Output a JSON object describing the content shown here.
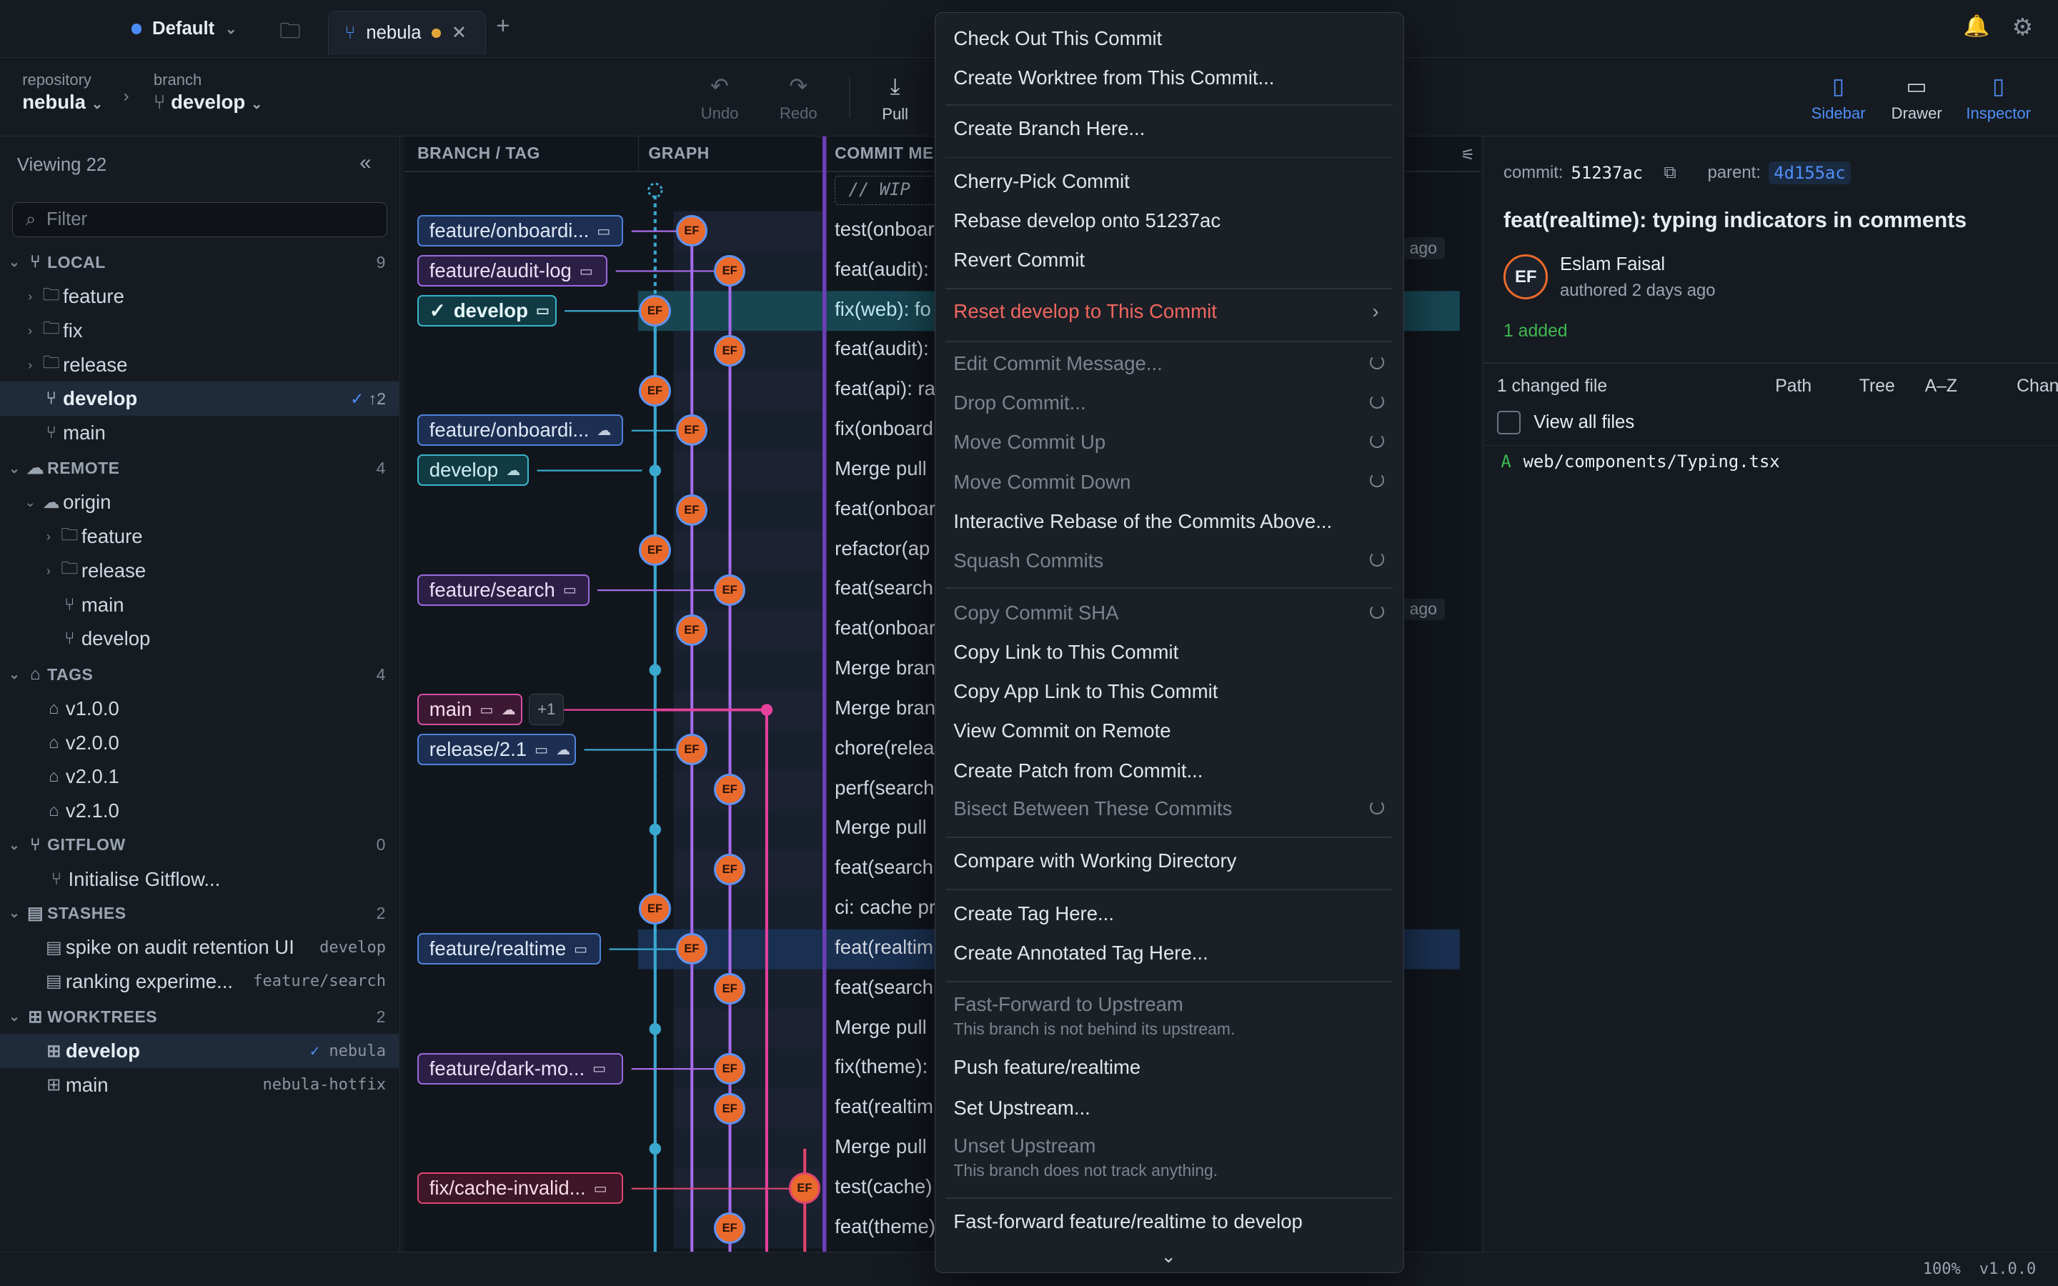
{
  "titlebar": {
    "workspace": "Default",
    "tab_label": "nebula",
    "new_tab": "+"
  },
  "toolbar": {
    "repo_caption": "repository",
    "repo_name": "nebula",
    "branch_caption": "branch",
    "branch_name": "develop",
    "undo": "Undo",
    "redo": "Redo",
    "pull": "Pull",
    "sidebar": "Sidebar",
    "drawer": "Drawer",
    "inspector": "Inspector"
  },
  "sidebar": {
    "viewing": "Viewing 22",
    "filter_placeholder": "Filter",
    "local": {
      "title": "LOCAL",
      "count": "9",
      "folders": [
        "feature",
        "fix",
        "release"
      ],
      "develop": "develop",
      "develop_sync": "↑2",
      "main": "main"
    },
    "remote": {
      "title": "REMOTE",
      "count": "4",
      "origin": "origin",
      "items": [
        "feature",
        "release",
        "main",
        "develop"
      ]
    },
    "tags": {
      "title": "TAGS",
      "count": "4",
      "items": [
        "v1.0.0",
        "v2.0.0",
        "v2.0.1",
        "v2.1.0"
      ]
    },
    "gitflow": {
      "title": "GITFLOW",
      "count": "0",
      "item": "Initialise Gitflow..."
    },
    "stashes": {
      "title": "STASHES",
      "count": "2",
      "items": [
        {
          "label": "spike on audit retention UI",
          "branch": "develop"
        },
        {
          "label": "ranking experime...",
          "branch": "feature/search"
        }
      ]
    },
    "worktrees": {
      "title": "WORKTREES",
      "count": "2",
      "items": [
        {
          "label": "develop",
          "repo": "nebula"
        },
        {
          "label": "main",
          "repo": "nebula-hotfix"
        }
      ]
    }
  },
  "graph": {
    "col_branch": "BRANCH / TAG",
    "col_graph": "GRAPH",
    "col_message": "COMMIT MES",
    "wip": "// WIP",
    "avatar": "EF",
    "ago": "ago",
    "rows": [
      {
        "branch": "feature/onboardi...",
        "msg": "test(onboar"
      },
      {
        "branch": "feature/audit-log",
        "msg": "feat(audit):"
      },
      {
        "branch": "develop",
        "msg": "fix(web): fo"
      },
      {
        "branch": "",
        "msg": "feat(audit):"
      },
      {
        "branch": "",
        "msg": "feat(api): ra"
      },
      {
        "branch": "feature/onboardi...",
        "msg": "fix(onboard"
      },
      {
        "branch": "develop",
        "msg": "Merge pull"
      },
      {
        "branch": "",
        "msg": "feat(onboar"
      },
      {
        "branch": "",
        "msg": "refactor(ap"
      },
      {
        "branch": "feature/search",
        "msg": "feat(search"
      },
      {
        "branch": "",
        "msg": "feat(onboar"
      },
      {
        "branch": "",
        "msg": "Merge bran"
      },
      {
        "branch": "main",
        "msg": "Merge bran",
        "extra": "+1"
      },
      {
        "branch": "release/2.1",
        "msg": "chore(relea"
      },
      {
        "branch": "",
        "msg": "perf(search"
      },
      {
        "branch": "",
        "msg": "Merge pull"
      },
      {
        "branch": "",
        "msg": "feat(search"
      },
      {
        "branch": "",
        "msg": "ci: cache pr"
      },
      {
        "branch": "feature/realtime",
        "msg": "feat(realtim"
      },
      {
        "branch": "",
        "msg": "feat(search"
      },
      {
        "branch": "",
        "msg": "Merge pull"
      },
      {
        "branch": "feature/dark-mo...",
        "msg": "fix(theme):"
      },
      {
        "branch": "",
        "msg": "feat(realtim"
      },
      {
        "branch": "",
        "msg": "Merge pull"
      },
      {
        "branch": "fix/cache-invalid...",
        "msg": "test(cache)"
      },
      {
        "branch": "",
        "msg": "feat(theme)"
      }
    ]
  },
  "inspector": {
    "commit_label": "commit:",
    "commit_sha": "51237ac",
    "parent_label": "parent:",
    "parent_sha": "4d155ac",
    "title": "feat(realtime): typing indicators in comments",
    "avatar": "EF",
    "author": "Eslam Faisal",
    "authored": "authored 2 days ago",
    "added": "1 added",
    "changed": "1 changed file",
    "views": [
      "Path",
      "Tree",
      "A–Z",
      "Change"
    ],
    "view_all": "View all files",
    "file_status": "A",
    "file_path": "web/components/Typing.tsx"
  },
  "status": {
    "zoom": "100%",
    "version": "v1.0.0"
  },
  "menu": {
    "checkout": "Check Out This Commit",
    "worktree": "Create Worktree from This Commit...",
    "branch_here": "Create Branch Here...",
    "cherry": "Cherry-Pick Commit",
    "rebase": "Rebase develop onto 51237ac",
    "revert": "Revert Commit",
    "reset": "Reset develop to This Commit",
    "edit_msg": "Edit Commit Message...",
    "drop": "Drop Commit...",
    "move_up": "Move Commit Up",
    "move_down": "Move Commit Down",
    "interactive": "Interactive Rebase of the Commits Above...",
    "squash": "Squash Commits",
    "copy_sha": "Copy Commit SHA",
    "copy_link": "Copy Link to This Commit",
    "copy_app_link": "Copy App Link to This Commit",
    "view_remote": "View Commit on Remote",
    "patch": "Create Patch from Commit...",
    "bisect": "Bisect Between These Commits",
    "compare": "Compare with Working Directory",
    "tag": "Create Tag Here...",
    "ann_tag": "Create Annotated Tag Here...",
    "ff_upstream": "Fast-Forward to Upstream",
    "ff_upstream_sub": "This branch is not behind its upstream.",
    "push": "Push feature/realtime",
    "set_upstream": "Set Upstream...",
    "unset_upstream": "Unset Upstream",
    "unset_upstream_sub": "This branch does not track anything.",
    "ff_develop": "Fast-forward feature/realtime to develop"
  },
  "colors": {
    "accent": "#4f8ff7",
    "danger": "#f0665f",
    "node": "#ea6a2b",
    "lane1": "#3aa8cf",
    "lane2": "#a56ce8",
    "lane3": "#e4419b"
  }
}
